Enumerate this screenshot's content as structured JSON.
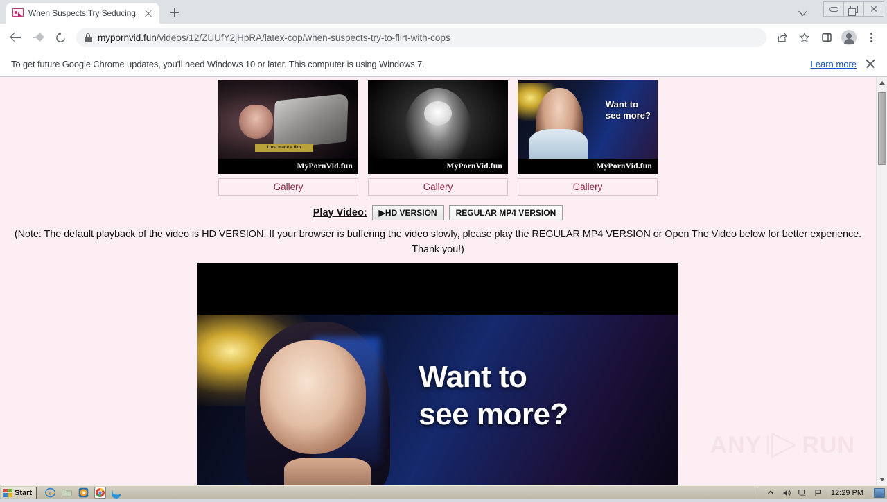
{
  "browser": {
    "tab": {
      "title": "When Suspects Try Seducing Police (",
      "favicon_icon": "video-thumb-icon",
      "close_icon": "close-icon"
    },
    "new_tab_icon": "plus-icon",
    "tab_search_icon": "chevron-down-icon",
    "window_controls": {
      "minimize_icon": "minimize-icon",
      "restore_icon": "restore-icon",
      "close_icon": "close-icon"
    },
    "toolbar": {
      "back_icon": "back-arrow-icon",
      "forward_icon": "forward-arrow-icon",
      "reload_icon": "reload-icon",
      "lock_icon": "lock-icon",
      "url_domain": "mypornvid.fun",
      "url_path": "/videos/12/ZUUfY2jHpRA/latex-cop/when-suspects-try-to-flirt-with-cops",
      "share_icon": "share-icon",
      "bookmark_icon": "star-icon",
      "side_panel_icon": "side-panel-icon",
      "profile_icon": "avatar-icon",
      "menu_icon": "three-dot-menu-icon"
    },
    "infobar": {
      "message": "To get future Google Chrome updates, you'll need Windows 10 or later. This computer is using Windows 7.",
      "link_label": "Learn more",
      "close_icon": "close-icon",
      "link_color": "#1a56c4"
    }
  },
  "page": {
    "background_color": "#fceef3",
    "thumbnails": [
      {
        "watermark": "MyPornVid.fun",
        "caption": "I just made a film",
        "button_label": "Gallery"
      },
      {
        "watermark": "MyPornVid.fun",
        "caption": "",
        "button_label": "Gallery"
      },
      {
        "watermark": "MyPornVid.fun",
        "overlay_line1": "Want to",
        "overlay_line2": "see more?",
        "button_label": "Gallery"
      }
    ],
    "play_row": {
      "label": "Play Video:",
      "hd_button": "▶HD VERSION",
      "mp4_button": "REGULAR MP4 VERSION"
    },
    "note": "(Note: The default playback of the video is HD VERSION. If your browser is buffering the video slowly, please play the REGULAR MP4 VERSION or Open The Video below for better experience. Thank you!)",
    "player": {
      "overlay_line1": "Want to",
      "overlay_line2": "see more?"
    },
    "watermark": {
      "left_text": "ANY",
      "right_text": "RUN",
      "play_icon": "play-triangle-icon",
      "color": "#e6c8d4"
    },
    "scrollbar": {
      "up_icon": "scroll-up-arrow-icon",
      "down_icon": "scroll-down-arrow-icon"
    }
  },
  "taskbar": {
    "start_label": "Start",
    "quick_launch": [
      "internet-explorer-icon",
      "windows-explorer-icon",
      "media-player-icon",
      "google-chrome-icon",
      "microsoft-edge-icon"
    ],
    "tray": {
      "show_hidden_icon": "chevron-up-icon",
      "volume_icon": "speaker-icon",
      "network_icon": "network-icon",
      "action_icon": "flag-icon",
      "show_desktop_icon": "show-desktop-icon"
    },
    "clock": "12:29 PM"
  }
}
